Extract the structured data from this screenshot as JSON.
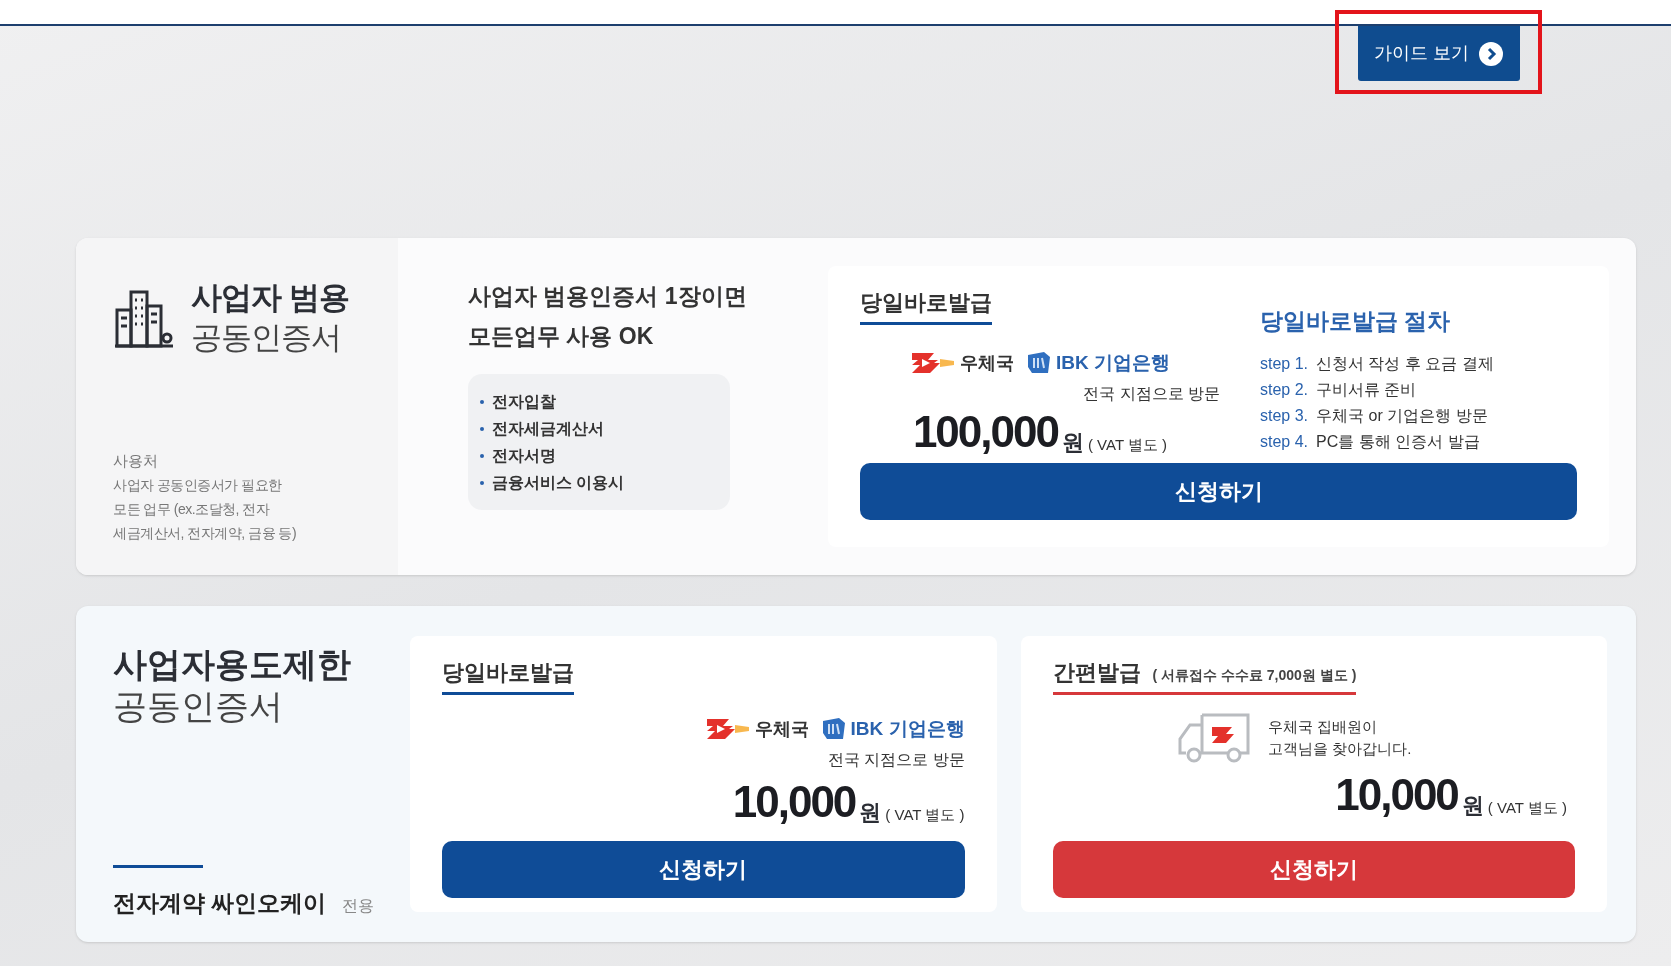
{
  "guide_button": {
    "label": "가이드 보기",
    "highlighted": true
  },
  "products": [
    {
      "kind": "general",
      "title_bold": "사업자 범용",
      "title": "공동인증서",
      "usage_label": "사용처",
      "usage_lines": [
        "사업자 공동인증서가 필요한",
        "모든 업무 (ex.조달청, 전자",
        "세금계산서, 전자계약, 금융 등)"
      ],
      "headline": [
        "사업자 범용인증서 1장이면",
        "모든업무 사용 OK"
      ],
      "features": [
        "전자입찰",
        "전자세금계산서",
        "전자서명",
        "금융서비스 이용시"
      ],
      "offers": [
        {
          "kind": "branch",
          "tab": "당일바로발급",
          "color": "#0f4c97",
          "banks": [
            "우체국",
            "IBK 기업은행"
          ],
          "note": "전국 지점으로 방문",
          "price": "100,000",
          "unit": "원",
          "vat": "( VAT 별도 )",
          "button": "신청하기",
          "procedure": {
            "title": "당일바로발급 절차",
            "steps": [
              {
                "label": "step 1.",
                "text": "신청서 작성 후 요금 결제"
              },
              {
                "label": "step 2.",
                "text": "구비서류 준비"
              },
              {
                "label": "step 3.",
                "text": "우체국 or 기업은행 방문"
              },
              {
                "label": "step 4.",
                "text": "PC를 통해 인증서 발급"
              }
            ]
          }
        }
      ]
    },
    {
      "kind": "limited",
      "title_bold": "사업자용도제한",
      "title": "공동인증서",
      "footer": {
        "name": "전자계약 싸인오케이",
        "suffix": "전용"
      },
      "offers": [
        {
          "kind": "branch",
          "tab": "당일바로발급",
          "color": "#0f4c97",
          "banks": [
            "우체국",
            "IBK 기업은행"
          ],
          "note": "전국 지점으로 방문",
          "price": "10,000",
          "unit": "원",
          "vat": "( VAT 별도 )",
          "button": "신청하기"
        },
        {
          "kind": "delivery",
          "tab": "간편발급",
          "tab_note": "( 서류접수 수수료 7,000원 별도 )",
          "color": "#d6383b",
          "delivery_lines": [
            "우체국 집배원이",
            "고객님을 찾아갑니다."
          ],
          "price": "10,000",
          "unit": "원",
          "vat": "( VAT 별도 )",
          "button": "신청하기"
        }
      ]
    }
  ]
}
